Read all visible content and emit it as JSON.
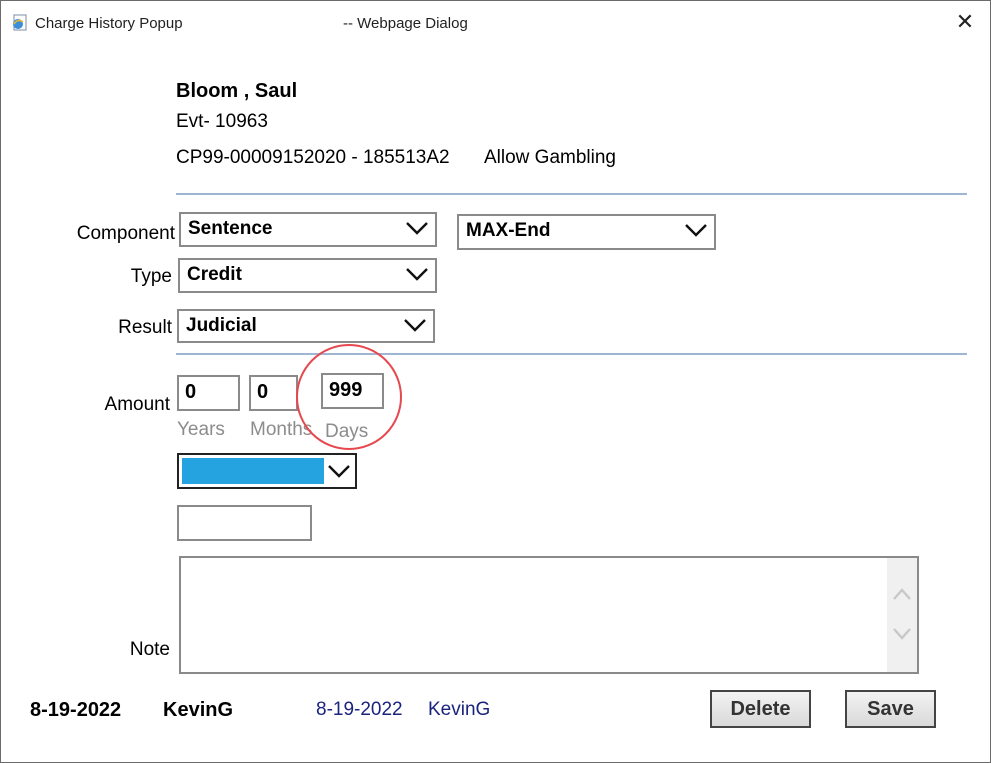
{
  "window": {
    "title": "Charge History Popup",
    "title_suffix": "-- Webpage Dialog",
    "close_symbol": "✕",
    "icon": "ie-page-icon"
  },
  "header": {
    "name": "Bloom , Saul",
    "event": "Evt- 10963",
    "charge": "CP99-00009152020 - 185513A2",
    "charge_desc": "Allow Gambling"
  },
  "form": {
    "component_label": "Component",
    "component_value": "Sentence",
    "component_sub_value": "MAX-End",
    "type_label": "Type",
    "type_value": "Credit",
    "result_label": "Result",
    "result_value": "Judicial",
    "amount_label": "Amount",
    "years_value": "0",
    "months_value": "0",
    "days_value": "999",
    "years_caption": "Years",
    "months_caption": "Months",
    "days_caption": "Days",
    "color_select_fill": "#25a3e0",
    "note_label": "Note",
    "note_value": ""
  },
  "footer": {
    "created_date": "8-19-2022",
    "created_user": "KevinG",
    "modified_date": "8-19-2022",
    "modified_user": "KevinG",
    "delete_label": "Delete",
    "save_label": "Save"
  },
  "colors": {
    "divider": "#9eb6d3",
    "highlight_circle": "#e5494f",
    "modified_text": "#1a237e"
  }
}
